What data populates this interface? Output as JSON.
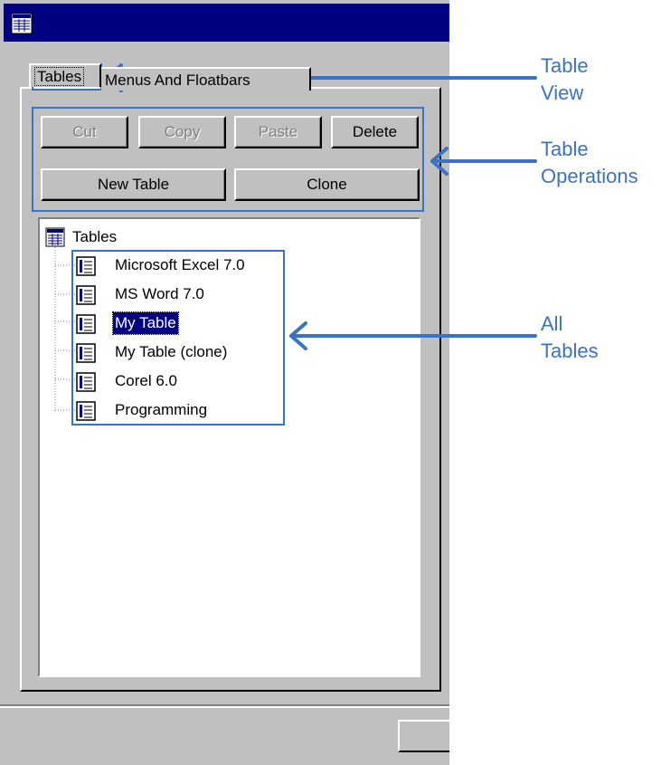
{
  "window": {
    "title": ""
  },
  "tabs": [
    {
      "label": "Tables",
      "active": true
    },
    {
      "label": "Menus And Floatbars",
      "active": false
    }
  ],
  "operations": {
    "cut": "Cut",
    "copy": "Copy",
    "paste": "Paste",
    "delete": "Delete",
    "new_table": "New Table",
    "clone": "Clone",
    "disabled": [
      "Cut",
      "Copy",
      "Paste"
    ]
  },
  "tree": {
    "root": "Tables",
    "items": [
      {
        "label": "Microsoft Excel 7.0",
        "selected": false
      },
      {
        "label": "MS Word 7.0",
        "selected": false
      },
      {
        "label": "My Table",
        "selected": true
      },
      {
        "label": "My Table (clone)",
        "selected": false
      },
      {
        "label": "Corel 6.0",
        "selected": false
      },
      {
        "label": "Programming",
        "selected": false
      }
    ]
  },
  "annotations": {
    "table_view_1": "Table",
    "table_view_2": "View",
    "table_ops_1": "Table",
    "table_ops_2": "Operations",
    "all_tables_1": "All",
    "all_tables_2": "Tables"
  },
  "colors": {
    "titlebar": "#000080",
    "window_face": "#c0c0c0",
    "selection": "#000080",
    "annotation": "#3a73c6"
  },
  "icons": [
    "table-window-icon",
    "table-item-icon",
    "arrow-left-icon"
  ]
}
